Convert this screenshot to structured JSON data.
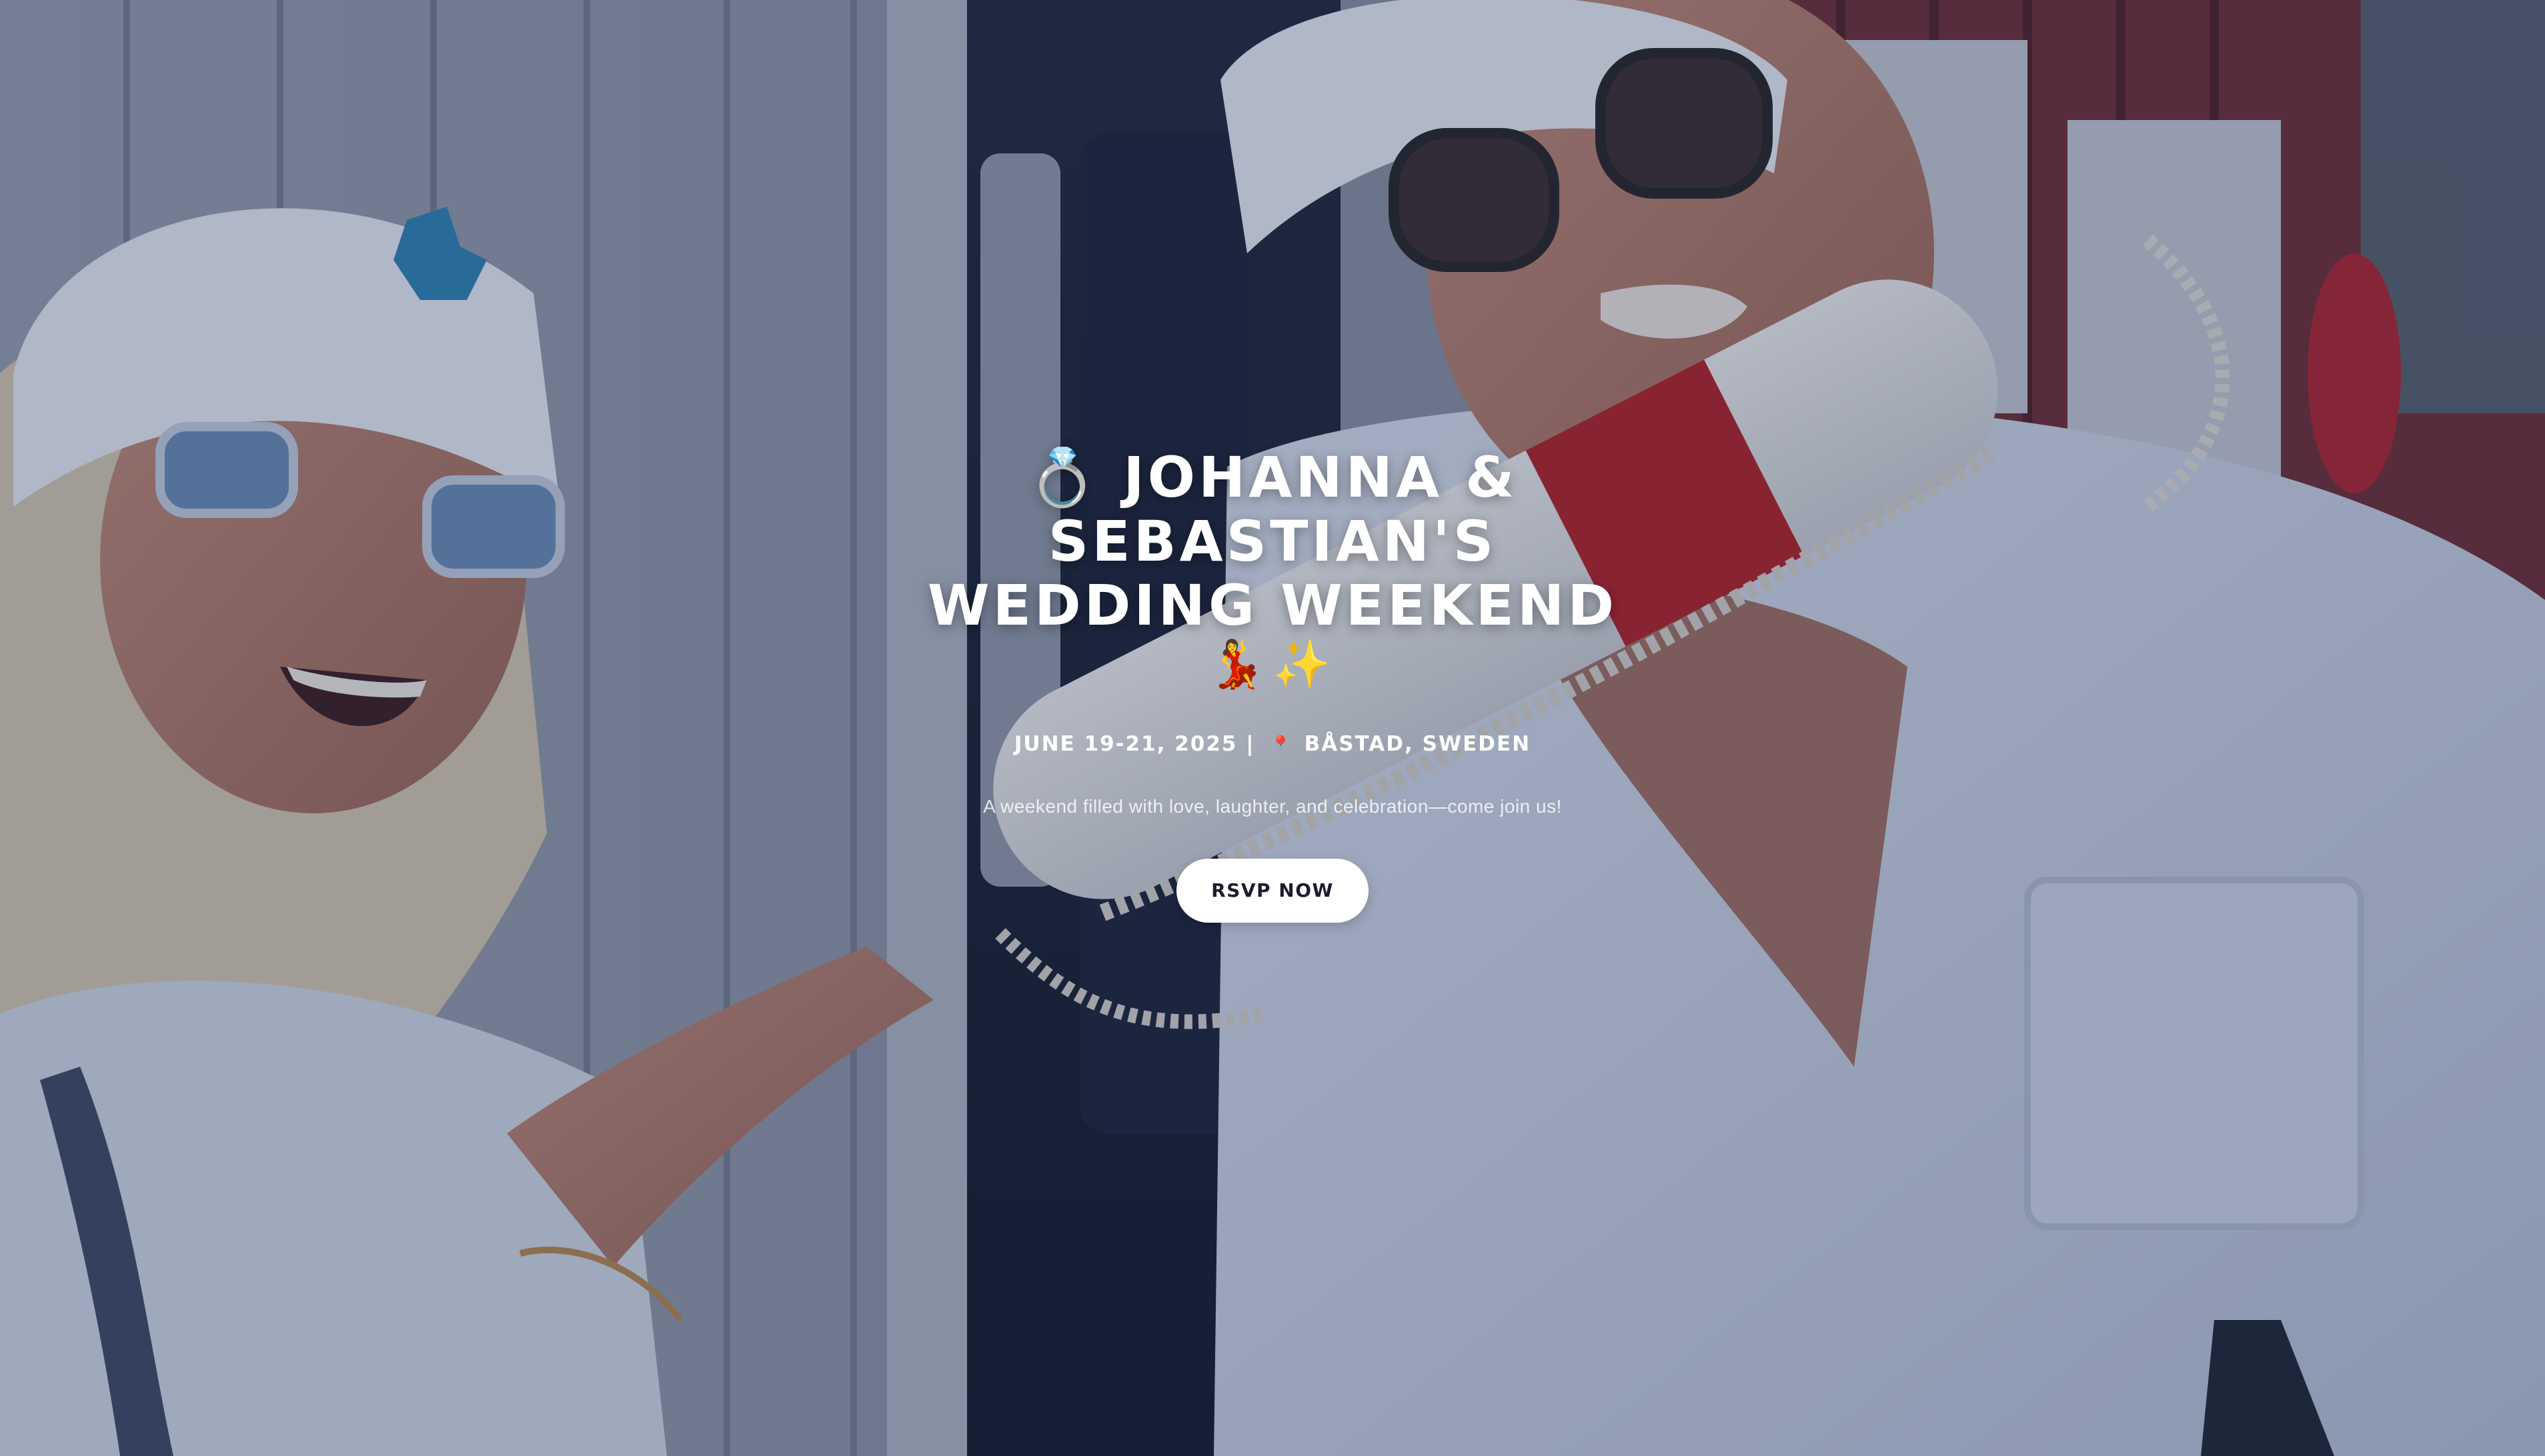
{
  "hero": {
    "title_lines": [
      "💍 Johanna &",
      "Sebastian's",
      "Wedding Weekend"
    ],
    "title_emojis": "💃✨",
    "date": "June 19-21, 2025",
    "separator": "|",
    "location_icon": "📍",
    "location": "Båstad, Sweden",
    "tagline": "A weekend filled with love, laughter, and celebration—come join us!",
    "rsvp_label": "RSVP NOW"
  },
  "colors": {
    "overlay": "#222e54",
    "button_bg": "#ffffff",
    "button_text": "#1c1c2e",
    "pin": "#e23b3b"
  }
}
